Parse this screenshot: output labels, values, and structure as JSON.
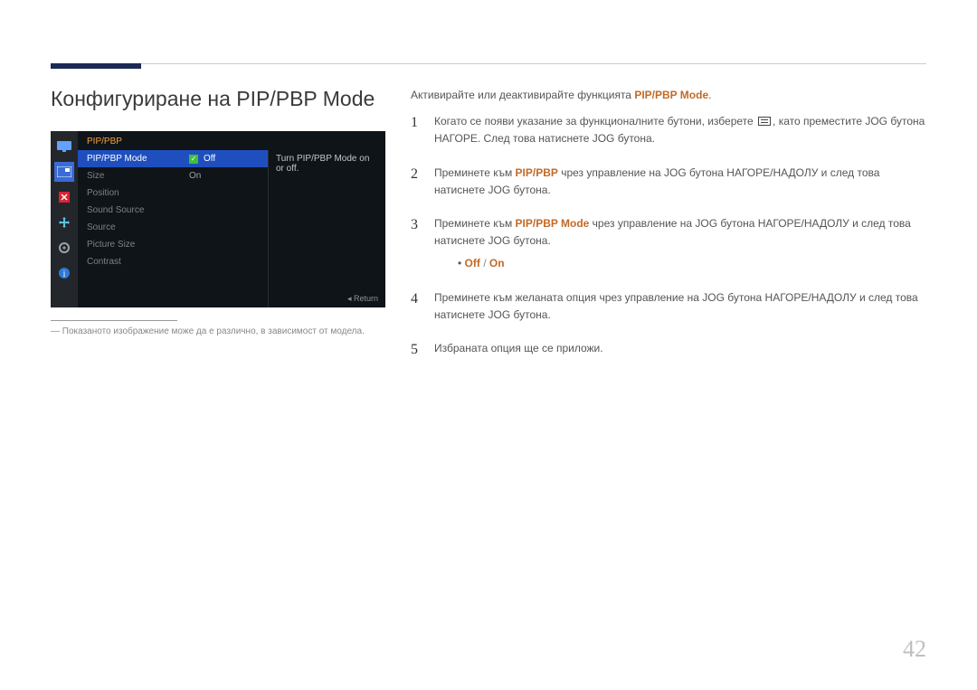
{
  "page": {
    "title": "Конфигуриране на PIP/PBP Mode",
    "footnote": "― Показаното изображение може да е различно, в зависимост от модела.",
    "page_number": "42"
  },
  "osd": {
    "header": "PIP/PBP",
    "items": [
      "PIP/PBP Mode",
      "Size",
      "Position",
      "Sound Source",
      "Source",
      "Picture Size",
      "Contrast"
    ],
    "options": [
      "Off",
      "On"
    ],
    "description": "Turn PIP/PBP Mode on or off.",
    "return": "Return"
  },
  "right": {
    "intro_prefix": "Активирайте или деактивирайте функцията ",
    "intro_em": "PIP/PBP Mode",
    "intro_suffix": ".",
    "steps": {
      "s1a": "Когато се появи указание за функционалните бутони, изберете ",
      "s1b": ", като преместите JOG бутона НАГОРЕ. След това натиснете JOG бутона.",
      "s2a": "Преминете към ",
      "s2em": "PIP/PBP",
      "s2b": " чрез управление на JOG бутона НАГОРЕ/НАДОЛУ и след това натиснете JOG бутона.",
      "s3a": "Преминете към ",
      "s3em": "PIP/PBP Mode",
      "s3b": " чрез управление на JOG бутона НАГОРЕ/НАДОЛУ и след това натиснете JOG бутона.",
      "bullet_off": "Off",
      "bullet_slash": " / ",
      "bullet_on": "On",
      "s4": "Преминете към желаната опция чрез управление на JOG бутона НАГОРЕ/НАДОЛУ и след това натиснете JOG бутона.",
      "s5": "Избраната опция ще се приложи."
    }
  }
}
